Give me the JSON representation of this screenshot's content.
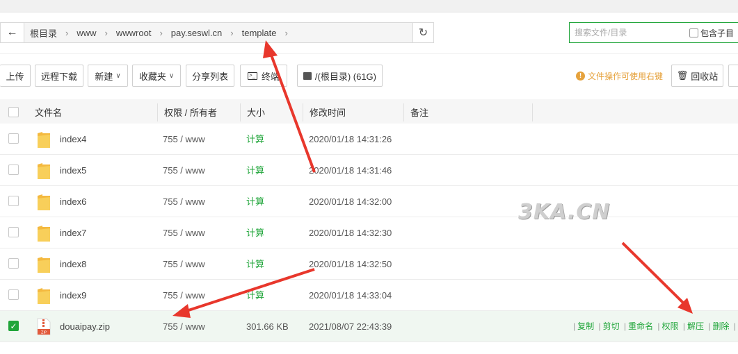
{
  "breadcrumb": [
    "根目录",
    "www",
    "wwwroot",
    "pay.seswl.cn",
    "template"
  ],
  "search": {
    "placeholder": "搜索文件/目录",
    "subdir_label": "包含子目"
  },
  "toolbar": {
    "upload": "上传",
    "remote_download": "远程下载",
    "new": "新建",
    "favorites": "收藏夹",
    "share_list": "分享列表",
    "terminal": "终端",
    "disk": "/(根目录) (61G)",
    "tip": "文件操作可使用右键",
    "recycle": "回收站"
  },
  "table": {
    "headers": {
      "name": "文件名",
      "perm": "权限 / 所有者",
      "size": "大小",
      "mtime": "修改时间",
      "note": "备注"
    },
    "rows": [
      {
        "name": "index4",
        "perm": "755 / www",
        "size": "计算",
        "mtime": "2020/01/18 14:31:26",
        "type": "folder",
        "checked": false
      },
      {
        "name": "index5",
        "perm": "755 / www",
        "size": "计算",
        "mtime": "2020/01/18 14:31:46",
        "type": "folder",
        "checked": false
      },
      {
        "name": "index6",
        "perm": "755 / www",
        "size": "计算",
        "mtime": "2020/01/18 14:32:00",
        "type": "folder",
        "checked": false
      },
      {
        "name": "index7",
        "perm": "755 / www",
        "size": "计算",
        "mtime": "2020/01/18 14:32:30",
        "type": "folder",
        "checked": false
      },
      {
        "name": "index8",
        "perm": "755 / www",
        "size": "计算",
        "mtime": "2020/01/18 14:32:50",
        "type": "folder",
        "checked": false
      },
      {
        "name": "index9",
        "perm": "755 / www",
        "size": "计算",
        "mtime": "2020/01/18 14:33:04",
        "type": "folder",
        "checked": false
      },
      {
        "name": "douaipay.zip",
        "perm": "755 / www",
        "size": "301.66 KB",
        "mtime": "2021/08/07 22:43:39",
        "type": "zip",
        "checked": true
      }
    ],
    "row_ops": [
      "复制",
      "剪切",
      "重命名",
      "权限",
      "解压",
      "删除"
    ]
  },
  "zip_icon_text": "ZIP",
  "watermark": "3KA.CN",
  "colors": {
    "accent": "#20a53a",
    "tip": "#e6a23c",
    "arrow": "#e8372c",
    "folder": "#f7c948"
  }
}
